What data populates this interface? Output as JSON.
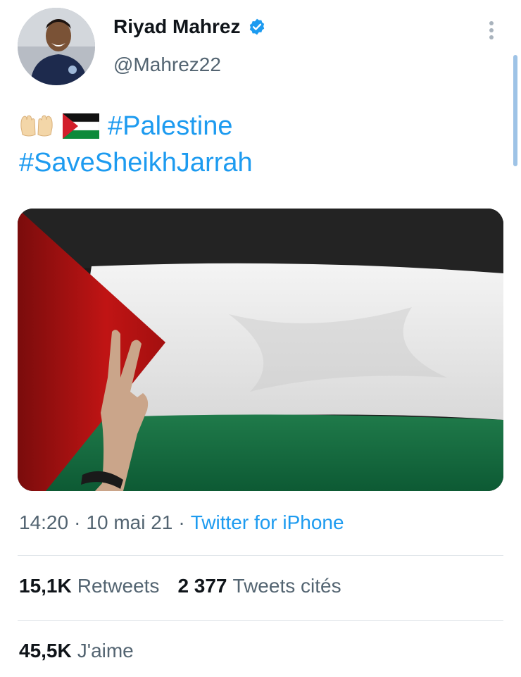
{
  "user": {
    "name": "Riyad Mahrez",
    "handle": "@Mahrez22",
    "verified": true
  },
  "tweet": {
    "emojis": [
      "palms-up-together-emoji",
      "palestine-flag-emoji"
    ],
    "hashtag_1": "#Palestine",
    "hashtag_2": "#SaveSheikhJarrah"
  },
  "media": {
    "description_icon": "palestine-flag-photo"
  },
  "meta": {
    "time": "14:20",
    "separator1": "·",
    "date": "10 mai 21",
    "separator2": "·",
    "source": "Twitter for iPhone"
  },
  "stats": {
    "retweets_count": "15,1K",
    "retweets_label": "Retweets",
    "quotes_count": "2 377",
    "quotes_label": "Tweets cités",
    "likes_count": "45,5K",
    "likes_label": "J'aime"
  },
  "colors": {
    "link": "#1d9bf0",
    "secondary_text": "#536471",
    "primary_text": "#0f1419",
    "verified_badge": "#1d9bf0"
  }
}
